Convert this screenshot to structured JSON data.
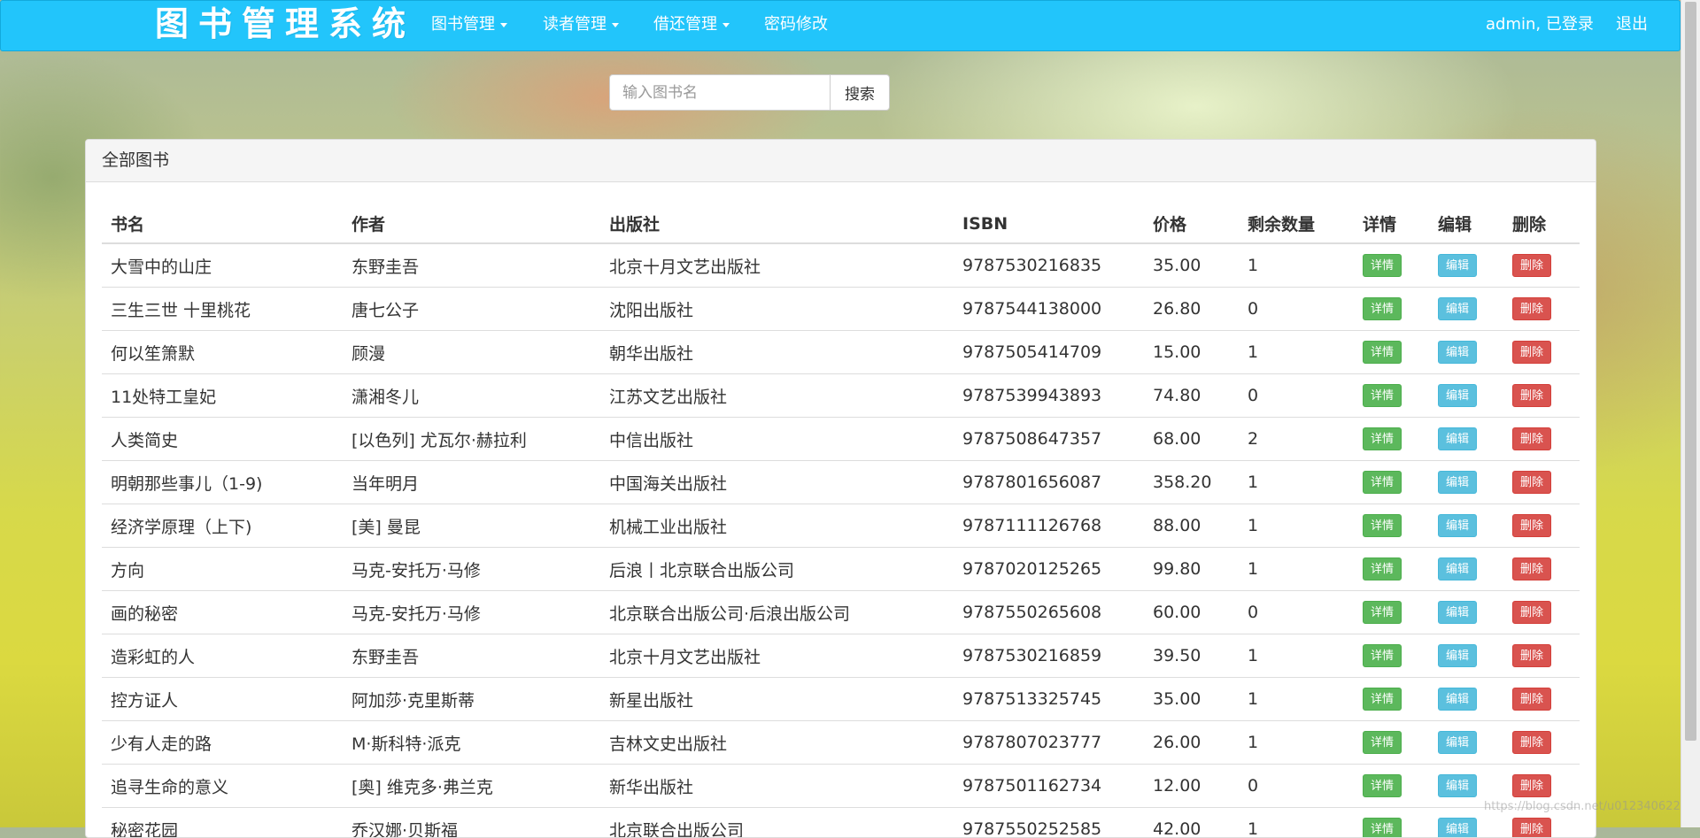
{
  "nav": {
    "brand": "图书管理系统",
    "menu": [
      {
        "label": "图书管理",
        "dropdown": true
      },
      {
        "label": "读者管理",
        "dropdown": true
      },
      {
        "label": "借还管理",
        "dropdown": true
      },
      {
        "label": "密码修改",
        "dropdown": false
      }
    ],
    "user_status": "admin, 已登录",
    "logout": "退出"
  },
  "search": {
    "placeholder": "输入图书名",
    "button": "搜索"
  },
  "panel": {
    "title": "全部图书"
  },
  "table": {
    "headers": [
      "书名",
      "作者",
      "出版社",
      "ISBN",
      "价格",
      "剩余数量",
      "详情",
      "编辑",
      "删除"
    ],
    "actions": {
      "detail": "详情",
      "edit": "编辑",
      "delete": "删除"
    },
    "rows": [
      {
        "title": "大雪中的山庄",
        "author": "东野圭吾",
        "publisher": "北京十月文艺出版社",
        "isbn": "9787530216835",
        "price": "35.00",
        "stock": "1"
      },
      {
        "title": "三生三世 十里桃花",
        "author": "唐七公子",
        "publisher": "沈阳出版社",
        "isbn": "9787544138000",
        "price": "26.80",
        "stock": "0"
      },
      {
        "title": "何以笙箫默",
        "author": "顾漫",
        "publisher": "朝华出版社",
        "isbn": "9787505414709",
        "price": "15.00",
        "stock": "1"
      },
      {
        "title": "11处特工皇妃",
        "author": "潇湘冬儿",
        "publisher": "江苏文艺出版社",
        "isbn": "9787539943893",
        "price": "74.80",
        "stock": "0"
      },
      {
        "title": "人类简史",
        "author": "[以色列] 尤瓦尔·赫拉利",
        "publisher": "中信出版社",
        "isbn": "9787508647357",
        "price": "68.00",
        "stock": "2"
      },
      {
        "title": "明朝那些事儿（1-9)",
        "author": "当年明月",
        "publisher": "中国海关出版社",
        "isbn": "9787801656087",
        "price": "358.20",
        "stock": "1"
      },
      {
        "title": "经济学原理（上下)",
        "author": "[美] 曼昆",
        "publisher": "机械工业出版社",
        "isbn": "9787111126768",
        "price": "88.00",
        "stock": "1"
      },
      {
        "title": "方向",
        "author": "马克-安托万·马修",
        "publisher": "后浪丨北京联合出版公司",
        "isbn": "9787020125265",
        "price": "99.80",
        "stock": "1"
      },
      {
        "title": "画的秘密",
        "author": "马克-安托万·马修",
        "publisher": "北京联合出版公司·后浪出版公司",
        "isbn": "9787550265608",
        "price": "60.00",
        "stock": "0"
      },
      {
        "title": "造彩虹的人",
        "author": "东野圭吾",
        "publisher": "北京十月文艺出版社",
        "isbn": "9787530216859",
        "price": "39.50",
        "stock": "1"
      },
      {
        "title": "控方证人",
        "author": "阿加莎·克里斯蒂",
        "publisher": "新星出版社",
        "isbn": "9787513325745",
        "price": "35.00",
        "stock": "1"
      },
      {
        "title": "少有人走的路",
        "author": "M·斯科特·派克",
        "publisher": "吉林文史出版社",
        "isbn": "9787807023777",
        "price": "26.00",
        "stock": "1"
      },
      {
        "title": "追寻生命的意义",
        "author": "[奥] 维克多·弗兰克",
        "publisher": "新华出版社",
        "isbn": "9787501162734",
        "price": "12.00",
        "stock": "0"
      },
      {
        "title": "秘密花园",
        "author": "乔汉娜·贝斯福",
        "publisher": "北京联合出版公司",
        "isbn": "9787550252585",
        "price": "42.00",
        "stock": "1"
      }
    ]
  },
  "watermark": "https://blog.csdn.net/u012340622",
  "colors": {
    "navbar": "#22c5fb",
    "detail_button": "#5cb85c",
    "edit_button": "#5bc0de",
    "delete_button": "#d9534f"
  }
}
